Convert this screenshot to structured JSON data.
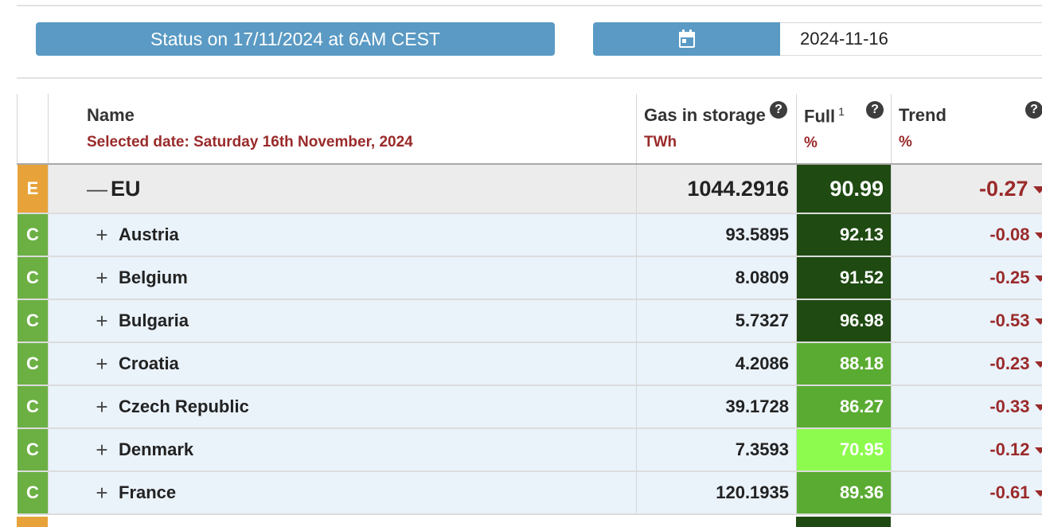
{
  "status": {
    "label": "Status on 17/11/2024 at 6AM CEST"
  },
  "datepicker": {
    "icon": "calendar-icon",
    "value": "2024-11-16"
  },
  "table": {
    "headers": {
      "name": "Name",
      "selected_date": "Selected date: Saturday 16th November, 2024",
      "gas": "Gas in storage",
      "gas_unit": "TWh",
      "full": "Full",
      "full_footnote": "1",
      "full_unit": "%",
      "trend": "Trend",
      "trend_unit": "%",
      "help_icon": "?"
    },
    "rows": [
      {
        "type": "E",
        "badge_color": "#e7a33a",
        "toggle": "—",
        "name": "EU",
        "gas": "1044.2916",
        "full": "90.99",
        "full_color": "#1f4a12",
        "trend": "-0.27"
      },
      {
        "type": "C",
        "badge_color": "#6cb044",
        "toggle": "+",
        "name": "Austria",
        "gas": "93.5895",
        "full": "92.13",
        "full_color": "#1f4a12",
        "trend": "-0.08"
      },
      {
        "type": "C",
        "badge_color": "#6cb044",
        "toggle": "+",
        "name": "Belgium",
        "gas": "8.0809",
        "full": "91.52",
        "full_color": "#1f4a12",
        "trend": "-0.25"
      },
      {
        "type": "C",
        "badge_color": "#6cb044",
        "toggle": "+",
        "name": "Bulgaria",
        "gas": "5.7327",
        "full": "96.98",
        "full_color": "#1f4a12",
        "trend": "-0.53"
      },
      {
        "type": "C",
        "badge_color": "#6cb044",
        "toggle": "+",
        "name": "Croatia",
        "gas": "4.2086",
        "full": "88.18",
        "full_color": "#5aab32",
        "trend": "-0.23"
      },
      {
        "type": "C",
        "badge_color": "#6cb044",
        "toggle": "+",
        "name": "Czech Republic",
        "gas": "39.1728",
        "full": "86.27",
        "full_color": "#5aab32",
        "trend": "-0.33"
      },
      {
        "type": "C",
        "badge_color": "#6cb044",
        "toggle": "+",
        "name": "Denmark",
        "gas": "7.3593",
        "full": "70.95",
        "full_color": "#8dfb4e",
        "trend": "-0.12"
      },
      {
        "type": "C",
        "badge_color": "#6cb044",
        "toggle": "+",
        "name": "France",
        "gas": "120.1935",
        "full": "89.36",
        "full_color": "#5aab32",
        "trend": "-0.61"
      }
    ]
  }
}
